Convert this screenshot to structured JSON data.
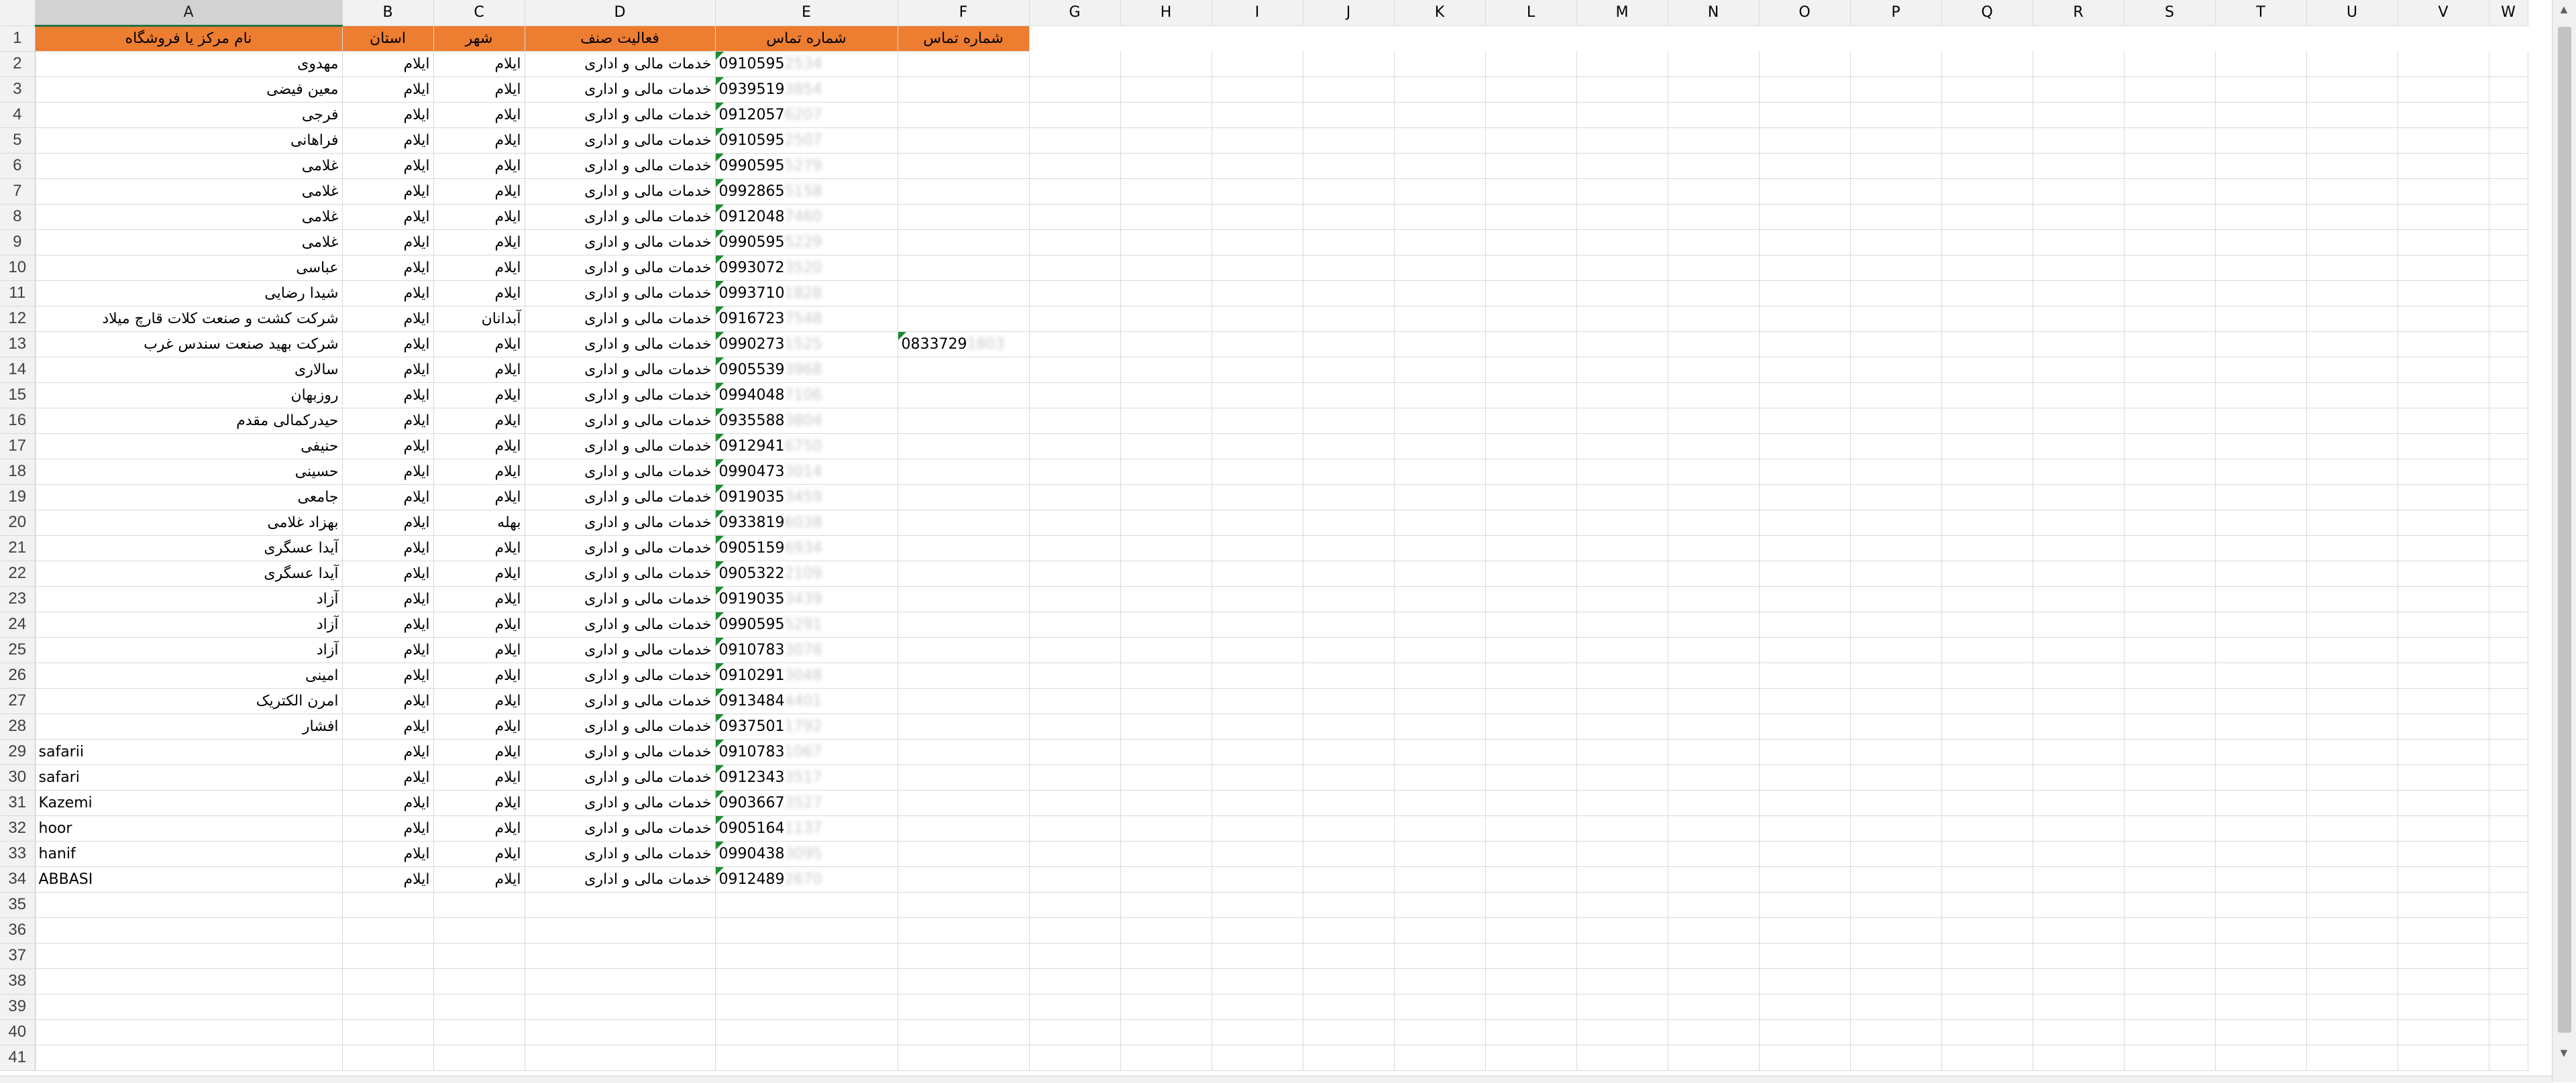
{
  "columns": [
    "A",
    "B",
    "C",
    "D",
    "E",
    "F",
    "G",
    "H",
    "I",
    "J",
    "K",
    "L",
    "M",
    "N",
    "O",
    "P",
    "Q",
    "R",
    "S",
    "T",
    "U",
    "V",
    "W"
  ],
  "header_row": {
    "row": "1",
    "A": "نام مرکز یا فروشگاه",
    "B": "استان",
    "C": "شهر",
    "D": "فعالیت صنف",
    "E": "شماره تماس",
    "F": "شماره تماس"
  },
  "rows": [
    {
      "row": "2",
      "name": "مهدوی",
      "province": "ایلام",
      "city": "ایلام",
      "activity": "خدمات مالی و اداری",
      "phone": "0910595",
      "phone_hidden": "2534",
      "phone2": "",
      "phone2_hidden": ""
    },
    {
      "row": "3",
      "name": "معین فیضی",
      "province": "ایلام",
      "city": "ایلام",
      "activity": "خدمات مالی و اداری",
      "phone": "0939519",
      "phone_hidden": "3854",
      "phone2": "",
      "phone2_hidden": ""
    },
    {
      "row": "4",
      "name": "فرجی",
      "province": "ایلام",
      "city": "ایلام",
      "activity": "خدمات مالی و اداری",
      "phone": "0912057",
      "phone_hidden": "6207",
      "phone2": "",
      "phone2_hidden": ""
    },
    {
      "row": "5",
      "name": "فراهانی",
      "province": "ایلام",
      "city": "ایلام",
      "activity": "خدمات مالی و اداری",
      "phone": "0910595",
      "phone_hidden": "2507",
      "phone2": "",
      "phone2_hidden": ""
    },
    {
      "row": "6",
      "name": "غلامی",
      "province": "ایلام",
      "city": "ایلام",
      "activity": "خدمات مالی و اداری",
      "phone": "0990595",
      "phone_hidden": "5279",
      "phone2": "",
      "phone2_hidden": ""
    },
    {
      "row": "7",
      "name": "غلامی",
      "province": "ایلام",
      "city": "ایلام",
      "activity": "خدمات مالی و اداری",
      "phone": "0992865",
      "phone_hidden": "5158",
      "phone2": "",
      "phone2_hidden": ""
    },
    {
      "row": "8",
      "name": "غلامی",
      "province": "ایلام",
      "city": "ایلام",
      "activity": "خدمات مالی و اداری",
      "phone": "0912048",
      "phone_hidden": "7460",
      "phone2": "",
      "phone2_hidden": ""
    },
    {
      "row": "9",
      "name": "غلامی",
      "province": "ایلام",
      "city": "ایلام",
      "activity": "خدمات مالی و اداری",
      "phone": "0990595",
      "phone_hidden": "5229",
      "phone2": "",
      "phone2_hidden": ""
    },
    {
      "row": "10",
      "name": "عباسی",
      "province": "ایلام",
      "city": "ایلام",
      "activity": "خدمات مالی و اداری",
      "phone": "0993072",
      "phone_hidden": "3520",
      "phone2": "",
      "phone2_hidden": ""
    },
    {
      "row": "11",
      "name": "شیدا رضایی",
      "province": "ایلام",
      "city": "ایلام",
      "activity": "خدمات مالی و اداری",
      "phone": "0993710",
      "phone_hidden": "1828",
      "phone2": "",
      "phone2_hidden": ""
    },
    {
      "row": "12",
      "name": "شرکت کشت و صنعت کلات قارچ میلاد",
      "province": "ایلام",
      "city": "آبدانان",
      "activity": "خدمات مالی و اداری",
      "phone": "0916723",
      "phone_hidden": "7548",
      "phone2": "",
      "phone2_hidden": ""
    },
    {
      "row": "13",
      "name": "شرکت بهید صنعت سندس غرب",
      "province": "ایلام",
      "city": "ایلام",
      "activity": "خدمات مالی و اداری",
      "phone": "0990273",
      "phone_hidden": "1525",
      "phone2": "0833729",
      "phone2_hidden": "1803"
    },
    {
      "row": "14",
      "name": "سالاری",
      "province": "ایلام",
      "city": "ایلام",
      "activity": "خدمات مالی و اداری",
      "phone": "0905539",
      "phone_hidden": "3968",
      "phone2": "",
      "phone2_hidden": ""
    },
    {
      "row": "15",
      "name": "روزبهان",
      "province": "ایلام",
      "city": "ایلام",
      "activity": "خدمات مالی و اداری",
      "phone": "0994048",
      "phone_hidden": "7106",
      "phone2": "",
      "phone2_hidden": ""
    },
    {
      "row": "16",
      "name": "حیدرکمالی مقدم",
      "province": "ایلام",
      "city": "ایلام",
      "activity": "خدمات مالی و اداری",
      "phone": "0935588",
      "phone_hidden": "3804",
      "phone2": "",
      "phone2_hidden": ""
    },
    {
      "row": "17",
      "name": "حنیفی",
      "province": "ایلام",
      "city": "ایلام",
      "activity": "خدمات مالی و اداری",
      "phone": "0912941",
      "phone_hidden": "6750",
      "phone2": "",
      "phone2_hidden": ""
    },
    {
      "row": "18",
      "name": "حسینی",
      "province": "ایلام",
      "city": "ایلام",
      "activity": "خدمات مالی و اداری",
      "phone": "0990473",
      "phone_hidden": "3014",
      "phone2": "",
      "phone2_hidden": ""
    },
    {
      "row": "19",
      "name": "جامعی",
      "province": "ایلام",
      "city": "ایلام",
      "activity": "خدمات مالی و اداری",
      "phone": "0919035",
      "phone_hidden": "3459",
      "phone2": "",
      "phone2_hidden": ""
    },
    {
      "row": "20",
      "name": "بهزاد غلامی",
      "province": "ایلام",
      "city": "بهله",
      "activity": "خدمات مالی و اداری",
      "phone": "0933819",
      "phone_hidden": "6038",
      "phone2": "",
      "phone2_hidden": ""
    },
    {
      "row": "21",
      "name": "آیدا عسگری",
      "province": "ایلام",
      "city": "ایلام",
      "activity": "خدمات مالی و اداری",
      "phone": "0905159",
      "phone_hidden": "6934",
      "phone2": "",
      "phone2_hidden": ""
    },
    {
      "row": "22",
      "name": "آیدا عسگری",
      "province": "ایلام",
      "city": "ایلام",
      "activity": "خدمات مالی و اداری",
      "phone": "0905322",
      "phone_hidden": "2109",
      "phone2": "",
      "phone2_hidden": ""
    },
    {
      "row": "23",
      "name": "آزاد",
      "province": "ایلام",
      "city": "ایلام",
      "activity": "خدمات مالی و اداری",
      "phone": "0919035",
      "phone_hidden": "3439",
      "phone2": "",
      "phone2_hidden": ""
    },
    {
      "row": "24",
      "name": "آزاد",
      "province": "ایلام",
      "city": "ایلام",
      "activity": "خدمات مالی و اداری",
      "phone": "0990595",
      "phone_hidden": "5291",
      "phone2": "",
      "phone2_hidden": ""
    },
    {
      "row": "25",
      "name": "آزاد",
      "province": "ایلام",
      "city": "ایلام",
      "activity": "خدمات مالی و اداری",
      "phone": "0910783",
      "phone_hidden": "3078",
      "phone2": "",
      "phone2_hidden": ""
    },
    {
      "row": "26",
      "name": "امینی",
      "province": "ایلام",
      "city": "ایلام",
      "activity": "خدمات مالی و اداری",
      "phone": "0910291",
      "phone_hidden": "3048",
      "phone2": "",
      "phone2_hidden": ""
    },
    {
      "row": "27",
      "name": "امرن الکتریک",
      "province": "ایلام",
      "city": "ایلام",
      "activity": "خدمات مالی و اداری",
      "phone": "0913484",
      "phone_hidden": "4401",
      "phone2": "",
      "phone2_hidden": ""
    },
    {
      "row": "28",
      "name": "افشار",
      "province": "ایلام",
      "city": "ایلام",
      "activity": "خدمات مالی و اداری",
      "phone": "0937501",
      "phone_hidden": "1792",
      "phone2": "",
      "phone2_hidden": ""
    },
    {
      "row": "29",
      "name": "safarii",
      "province": "ایلام",
      "city": "ایلام",
      "activity": "خدمات مالی و اداری",
      "phone": "0910783",
      "phone_hidden": "1067",
      "phone2": "",
      "phone2_hidden": ""
    },
    {
      "row": "30",
      "name": "safari",
      "province": "ایلام",
      "city": "ایلام",
      "activity": "خدمات مالی و اداری",
      "phone": "0912343",
      "phone_hidden": "3517",
      "phone2": "",
      "phone2_hidden": ""
    },
    {
      "row": "31",
      "name": "Kazemi",
      "province": "ایلام",
      "city": "ایلام",
      "activity": "خدمات مالی و اداری",
      "phone": "0903667",
      "phone_hidden": "3527",
      "phone2": "",
      "phone2_hidden": ""
    },
    {
      "row": "32",
      "name": "hoor",
      "province": "ایلام",
      "city": "ایلام",
      "activity": "خدمات مالی و اداری",
      "phone": "0905164",
      "phone_hidden": "1137",
      "phone2": "",
      "phone2_hidden": ""
    },
    {
      "row": "33",
      "name": "hanif",
      "province": "ایلام",
      "city": "ایلام",
      "activity": "خدمات مالی و اداری",
      "phone": "0990438",
      "phone_hidden": "3095",
      "phone2": "",
      "phone2_hidden": ""
    },
    {
      "row": "34",
      "name": "ABBASI",
      "province": "ایلام",
      "city": "ایلام",
      "activity": "خدمات مالی و اداری",
      "phone": "0912489",
      "phone_hidden": "2670",
      "phone2": "",
      "phone2_hidden": ""
    }
  ],
  "empty_rows": [
    "35",
    "36",
    "37",
    "38",
    "39",
    "40",
    "41"
  ],
  "colors": {
    "header_fill": "#ed7d31",
    "header_text": "#ffffff",
    "comment_marker": "#1a8c2f",
    "selected_col": "#217346"
  }
}
